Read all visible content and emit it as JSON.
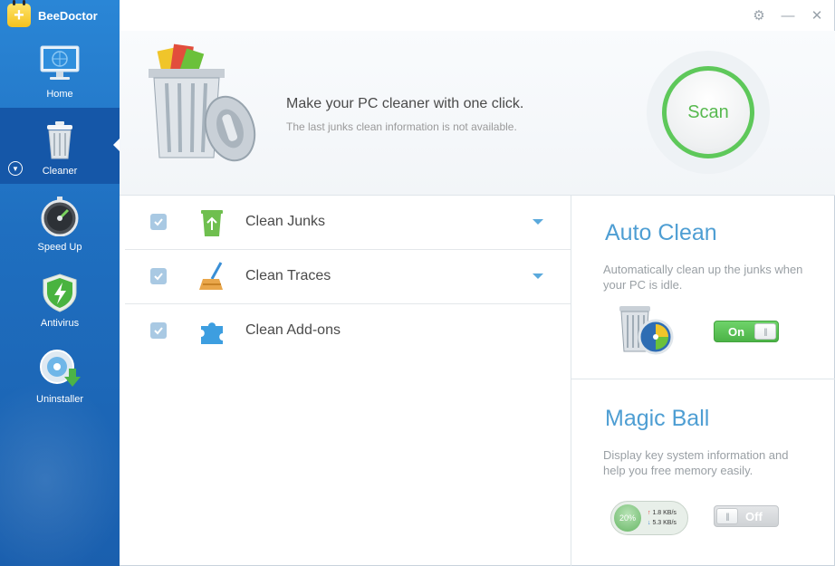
{
  "app": {
    "name": "BeeDoctor"
  },
  "sidebar": {
    "items": [
      {
        "label": "Home",
        "active": false,
        "icon": "monitor-icon"
      },
      {
        "label": "Cleaner",
        "active": true,
        "icon": "trash-icon"
      },
      {
        "label": "Speed Up",
        "active": false,
        "icon": "stopwatch-icon"
      },
      {
        "label": "Antivirus",
        "active": false,
        "icon": "shield-bolt-icon"
      },
      {
        "label": "Uninstaller",
        "active": false,
        "icon": "disc-download-icon"
      }
    ]
  },
  "titlebar": {
    "settings_glyph": "⚙",
    "minimize_glyph": "—",
    "close_glyph": "✕"
  },
  "hero": {
    "title": "Make your PC cleaner with one click.",
    "subtitle": "The last junks clean information is not available.",
    "scan_label": "Scan"
  },
  "clean_items": [
    {
      "label": "Clean Junks",
      "checked": true,
      "icon": "recycle-bin-icon",
      "has_dropdown": true
    },
    {
      "label": "Clean Traces",
      "checked": true,
      "icon": "broom-icon",
      "has_dropdown": true
    },
    {
      "label": "Clean Add-ons",
      "checked": true,
      "icon": "puzzle-icon",
      "has_dropdown": false
    }
  ],
  "auto_clean": {
    "title": "Auto Clean",
    "description": "Automatically clean up the junks when your PC is idle.",
    "toggle_label": "On",
    "enabled": true
  },
  "magic_ball": {
    "title": "Magic Ball",
    "description": "Display key system information and help you free memory easily.",
    "toggle_label": "Off",
    "enabled": false,
    "memory_percent": "20%",
    "upload_speed": "1.8 KB/s",
    "download_speed": "5.3 KB/s"
  },
  "colors": {
    "sidebar": "#1f6fc0",
    "accent_blue": "#4e9ed3",
    "scan_green": "#5ec85a"
  }
}
